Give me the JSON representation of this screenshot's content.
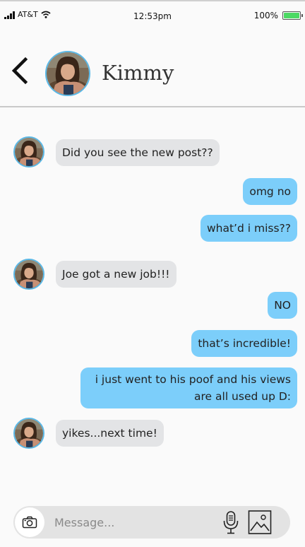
{
  "status_bar": {
    "carrier": "AT&T",
    "time": "12:53pm",
    "battery": "100%",
    "battery_level": 1.0,
    "battery_color": "#4cd964"
  },
  "header": {
    "back_icon": "chevron-left-icon",
    "contact_name": "Kimmy"
  },
  "messages": [
    {
      "direction": "incoming",
      "text": "Did you see the new post??"
    },
    {
      "direction": "outgoing",
      "text": "omg no"
    },
    {
      "direction": "outgoing",
      "text": "what’d i miss??"
    },
    {
      "direction": "incoming",
      "text": "Joe got a new job!!!"
    },
    {
      "direction": "outgoing",
      "text": "NO"
    },
    {
      "direction": "outgoing",
      "text": "that’s incredible!"
    },
    {
      "direction": "outgoing",
      "text": "i just went to his poof and his views are all used up D:"
    },
    {
      "direction": "incoming",
      "text": "yikes...next time!"
    }
  ],
  "composer": {
    "placeholder": "Message...",
    "camera_icon": "camera-icon",
    "mic_icon": "microphone-icon",
    "photo_icon": "photo-gallery-icon"
  },
  "colors": {
    "incoming_bubble": "#e3e4e6",
    "outgoing_bubble": "#7ccefa",
    "avatar_ring": "#5ab8e6"
  }
}
